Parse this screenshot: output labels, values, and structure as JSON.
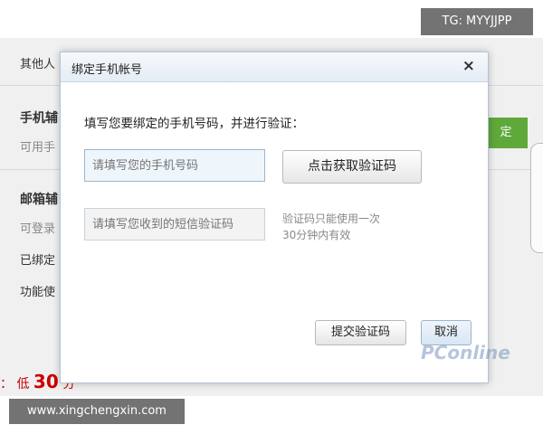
{
  "overlay": {
    "tg_label": "TG: MYYJJPP",
    "site_label": "www.xingchengxin.com"
  },
  "background": {
    "row1": "其他人",
    "row2": "手机辅",
    "row3": "可用手",
    "row4": "邮箱辅",
    "row5": "可登录",
    "row6": "已绑定",
    "row7": "功能使",
    "green_button": "定",
    "score_prefix": "：",
    "score_low": "低",
    "score_value": "30",
    "score_unit": "分"
  },
  "dialog": {
    "title": "绑定手机帐号",
    "close_glyph": "×",
    "instruction": "填写您要绑定的手机号码，并进行验证：",
    "phone_placeholder": "请填写您的手机号码",
    "get_code_label": "点击获取验证码",
    "code_placeholder": "请填写您收到的短信验证码",
    "note_line1": "验证码只能使用一次",
    "note_line2": "30分钟内有效",
    "submit_label": "提交验证码",
    "cancel_label": "取消",
    "watermark": "PConline"
  },
  "colors": {
    "accent_green": "#5fa83a",
    "dialog_border": "#b5c4d6",
    "score_red": "#cc0000"
  }
}
